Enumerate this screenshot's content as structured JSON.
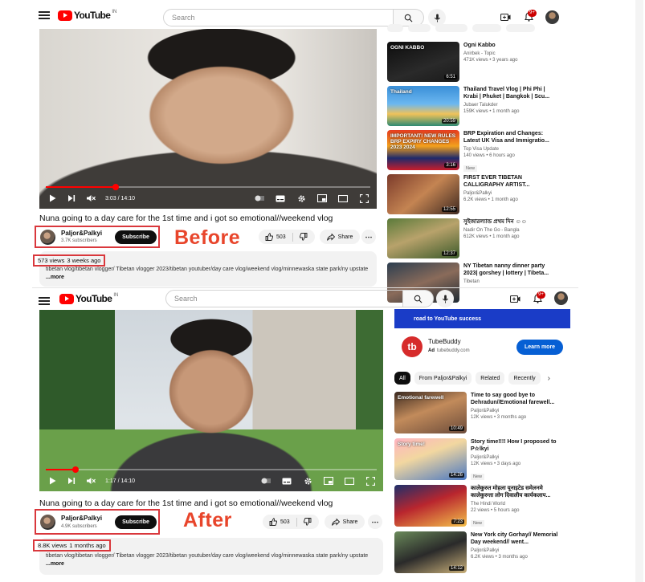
{
  "header": {
    "logo_text": "YouTube",
    "logo_sup": "IN",
    "search_placeholder": "Search",
    "notif_badge": "9+"
  },
  "before": {
    "label": "Before",
    "video": {
      "time": "3:03 / 14:10",
      "progress": 0.215
    },
    "title": "Nuna going to a day care for the 1st time and i got so emotional//weekend vlog",
    "channel": {
      "name": "Paljor&Palkyi",
      "subscribers": "3.7K subscribers",
      "subscribe_label": "Subscribe"
    },
    "likes": "503",
    "share_label": "Share",
    "views": "573 views",
    "posted": "3 weeks ago",
    "description": "tibetan vlog/tibetan vlogger/ Tibetan vlogger 2023/tibetan youtuber/day care vlog/weekend vlog/minnewaska state park/ny upstate",
    "more_label": "...more",
    "recommendations": [
      {
        "title": "Ogni Kabbo",
        "channel": "Anirbek - Topic",
        "meta": "471K views • 3 years ago",
        "duration": "6:51",
        "thumb_text": "OGNI KABBO",
        "new": ""
      },
      {
        "title": "Thailand Travel Vlog | Phi Phi | Krabi | Phuket | Bangkok | Scu...",
        "channel": "Jubaer Talukder",
        "meta": "159K views • 1 month ago",
        "duration": "20:59",
        "thumb_text": "Thailand",
        "new": ""
      },
      {
        "title": "BRP Expiration and Changes: Latest UK Visa and Immigratio...",
        "channel": "Top Visa Update",
        "meta": "140 views • 6 hours ago",
        "duration": "3:16",
        "thumb_text": "IMPORTANT! NEW RULES BRP EXPIRY CHANGES 2023 2024",
        "new": "New"
      },
      {
        "title": "FIRST EVER TIBETAN CALLIGRAPHY ARTIST...",
        "channel": "Paljor&Palkyi",
        "meta": "6.2K views • 1 month ago",
        "duration": "12:55",
        "thumb_text": "",
        "new": ""
      },
      {
        "title": "সুইজারল্যান্ড প্রথম দিন ☺☺",
        "channel": "Nadir On The Go - Bangla",
        "meta": "612K views • 1 month ago",
        "duration": "12:37",
        "thumb_text": "",
        "new": ""
      },
      {
        "title": "NY Tibetan nanny dinner party 2023| gorshey | lottery | Tibeta...",
        "channel": "Tibetan",
        "meta": "",
        "duration": "",
        "thumb_text": "",
        "new": ""
      }
    ]
  },
  "after": {
    "label": "After",
    "video": {
      "time": "1:17 / 14:10",
      "progress": 0.09
    },
    "title": "Nuna going to a day care for the 1st time and i got so emotional//weekend vlog",
    "channel": {
      "name": "Paljor&Palkyi",
      "subscribers": "4.9K subscribers",
      "subscribe_label": "Subscribe"
    },
    "likes": "503",
    "share_label": "Share",
    "views": "8.8K views",
    "posted": "1 months ago",
    "description": "tibetan vlog/tibetan vlogger/ Tibetan vlogger 2023/tibetan youtuber/day care vlog/weekend vlog/minnewaska state park/ny upstate",
    "more_label": "...more",
    "ad": {
      "banner": "road to YouTube success",
      "name": "TubeBuddy",
      "ad_tag": "Ad",
      "domain": "tubebuddy.com",
      "cta": "Learn more",
      "logo_letters": "tb"
    },
    "chips": [
      "All",
      "From Paljor&Palkyi",
      "Related",
      "Recently"
    ],
    "recommendations": [
      {
        "title": "Time to say good bye to Dehradun//Emotional farewell...",
        "channel": "Paljor&Palkyi",
        "meta": "12K views • 3 months ago",
        "duration": "10:49",
        "thumb_text": "Emotional farewell",
        "new": ""
      },
      {
        "title": "Story time!!!! How I proposed to P☆lkyi",
        "channel": "Paljor&Palkyi",
        "meta": "12K views • 3 days ago",
        "duration": "14:26",
        "thumb_text": "Story time!",
        "new": "New"
      },
      {
        "title": "कालेकुरुत मोहला यूनाइटेड समेलनमे कालेकुरुत्ता लोग दिवालीय कार्यकलाप...",
        "channel": "The Hindi World",
        "meta": "22 views • 5 hours ago",
        "duration": "7:23",
        "thumb_text": "",
        "new": "New"
      },
      {
        "title": "New York city Gorhay// Memorial Day weekend// went...",
        "channel": "Paljor&Palkyi",
        "meta": "6.2K views • 3 months ago",
        "duration": "14:12",
        "thumb_text": "",
        "new": ""
      }
    ]
  }
}
